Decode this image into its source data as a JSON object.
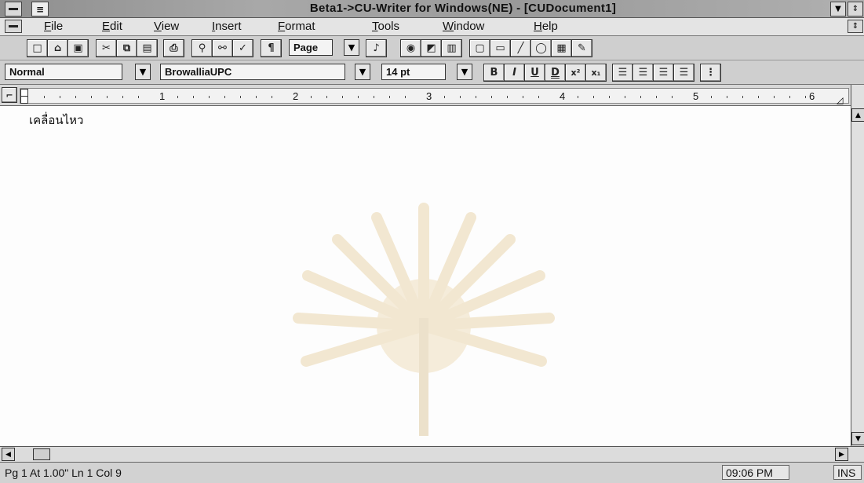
{
  "window": {
    "title": "Beta1->CU-Writer for Windows(NE) - [CUDocument1]"
  },
  "menu": [
    "File",
    "Edit",
    "View",
    "Insert",
    "Format",
    "Tools",
    "Window",
    "Help"
  ],
  "toolbar1": {
    "view_value": "Page"
  },
  "toolbar2": {
    "style_value": "Normal",
    "font_value": "BrowalliaUPC",
    "size_value": "14 pt",
    "bold": "B",
    "italic": "I",
    "underline": "U",
    "double_underline": "D"
  },
  "ruler": {
    "numbers": [
      "1",
      "2",
      "3",
      "4",
      "5",
      "6"
    ]
  },
  "document": {
    "text": "เคลื่อนไหว"
  },
  "status": {
    "position": "Pg  1 At 1.00\"  Ln  1  Col  9",
    "time": "09:06 PM",
    "mode": "INS"
  }
}
